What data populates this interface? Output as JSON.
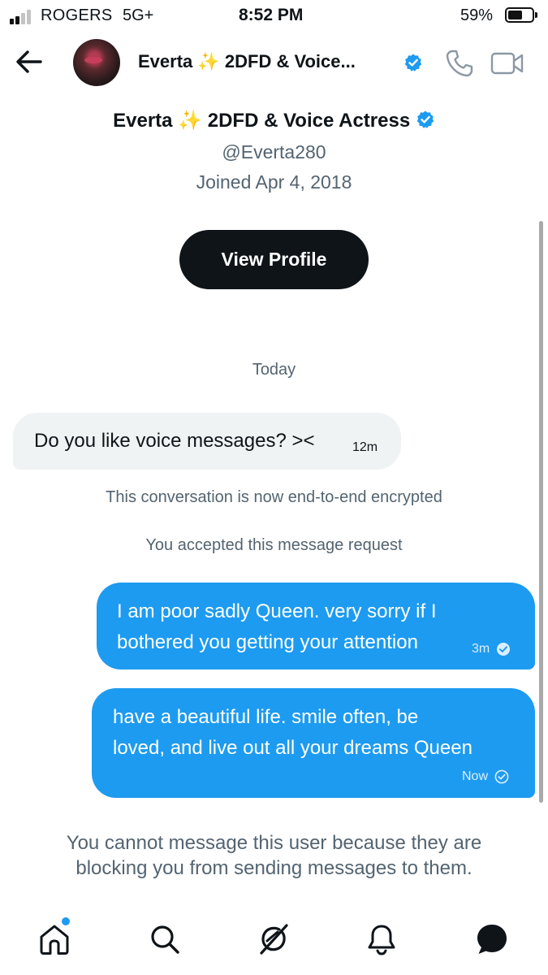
{
  "status_bar": {
    "carrier": "ROGERS",
    "network": "5G+",
    "time": "8:52 PM",
    "battery": "59%",
    "battery_level": 0.59,
    "signal_bars": 2
  },
  "header": {
    "name": "Everta ✨ 2DFD & Voice...",
    "verified": true
  },
  "profile": {
    "name": "Everta ✨ 2DFD & Voice Actress",
    "handle": "@Everta280",
    "joined": "Joined Apr 4, 2018",
    "view_profile_label": "View Profile"
  },
  "conversation": {
    "day_label": "Today",
    "incoming": {
      "text": "Do you like voice messages? ><",
      "time": "12m"
    },
    "system_messages": [
      "This conversation is now end-to-end encrypted",
      "You accepted this message request"
    ],
    "outgoing": [
      {
        "lines": [
          "I am poor sadly Queen. very sorry if I",
          "bothered you getting your attention"
        ],
        "time": "3m",
        "status": "sent"
      },
      {
        "lines": [
          "have a beautiful life.  smile often, be",
          "loved, and live out all your dreams Queen"
        ],
        "time": "Now",
        "status": "sent"
      }
    ]
  },
  "blocked_notice": {
    "line1": "You cannot message this user because they are",
    "line2": "blocking you from sending messages to them."
  },
  "tab_bar": {
    "tabs": [
      "home-icon",
      "search-icon",
      "grok-icon",
      "notifications-icon",
      "messages-icon"
    ],
    "active": "messages-icon",
    "home_has_badge": true
  },
  "colors": {
    "accent": "#1d9bf0",
    "text": "#0f1419",
    "secondary_text": "#536471",
    "incoming_bubble": "#eff3f4"
  }
}
